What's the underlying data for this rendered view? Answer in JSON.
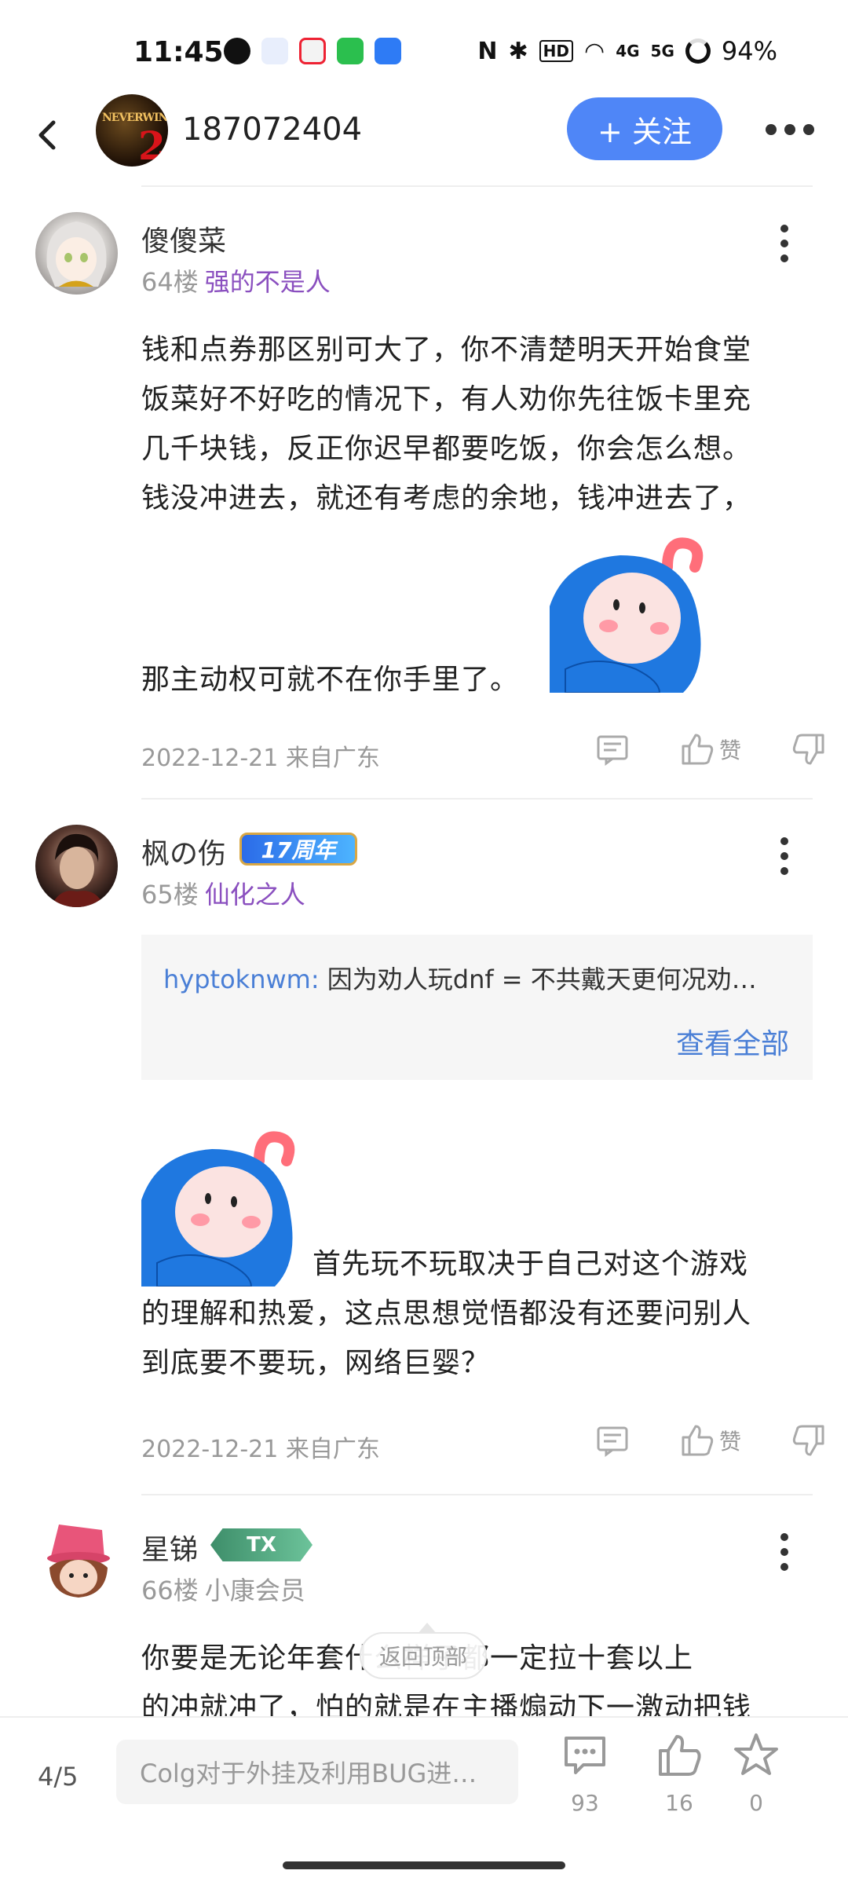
{
  "status_bar": {
    "time": "11:45",
    "battery": "94%",
    "network_4g": "4G",
    "network_5g": "5G"
  },
  "header": {
    "forum_name": "187072404",
    "follow_label": "+ 关注"
  },
  "posts": [
    {
      "username": "傻傻菜",
      "floor": "64楼",
      "title": "强的不是人",
      "lines": [
        "钱和点券那区别可大了，你不清楚明天开始食堂",
        "饭菜好不好吃的情况下，有人劝你先往饭卡里充",
        "几千块钱，反正你迟早都要吃饭，你会怎么想。",
        "钱没冲进去，就还有考虑的余地，钱冲进去了，",
        "那主动权可就不在你手里了。"
      ],
      "date": "2022-12-21 来自广东",
      "like_label": "赞"
    },
    {
      "username": "枫の伤",
      "badge": "17周年",
      "floor": "65楼",
      "title": "仙化之人",
      "quote_user": "hyptoknwm:",
      "quote_text": "因为劝人玩dnf = 不共戴天更何况劝…",
      "quote_more": "查看全部",
      "lines": [
        "首先玩不玩取决于自己对这个游戏",
        "的理解和热爱，这点思想觉悟都没有还要问别人",
        "到底要不要玩，网络巨婴？"
      ],
      "date": "2022-12-21 来自广东",
      "like_label": "赞"
    },
    {
      "username": "星锑",
      "badge": "TX",
      "floor": "66楼",
      "title": "小康会员",
      "lines": [
        "你要是无论年套什么样子都一定拉十套以上",
        "的冲就冲了，怕的就是在主播煽动下一激动把钱"
      ]
    }
  ],
  "back_to_top": "返回顶部",
  "bottom_bar": {
    "page": "4/5",
    "input_placeholder": "Colg对于外挂及利用BUG进…",
    "comments": "93",
    "likes": "16",
    "favorites": "0"
  },
  "colors": {
    "accent": "#4f86f7",
    "title_purple": "#8a4fbf",
    "link_blue": "#4a7fd6"
  }
}
